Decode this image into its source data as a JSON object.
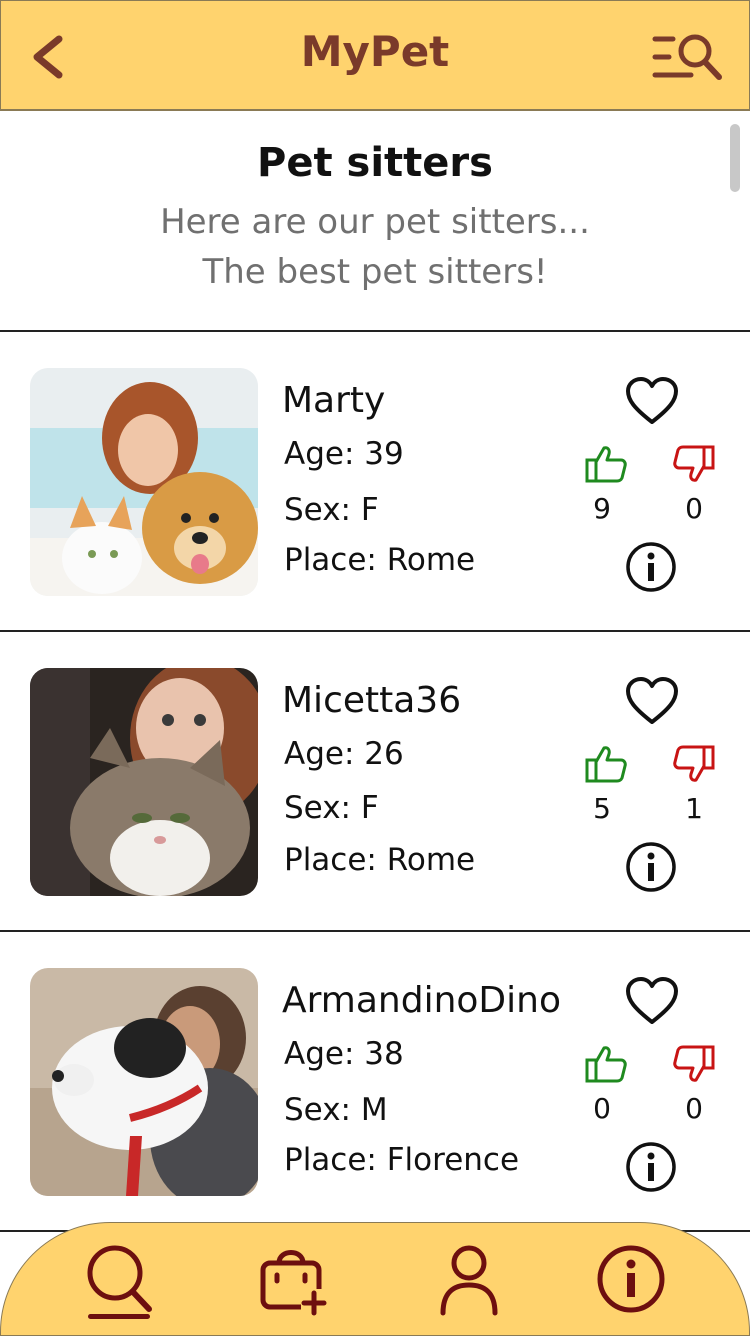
{
  "app": {
    "title": "MyPet"
  },
  "intro": {
    "title": "Pet sitters",
    "line1": "Here are our pet sitters...",
    "line2": "The best pet sitters!"
  },
  "sitters": [
    {
      "name": "Marty",
      "age": "Age: 39",
      "sex": "Sex: F",
      "place": "Place: Rome",
      "likes": "9",
      "dislikes": "0"
    },
    {
      "name": "Micetta36",
      "age": "Age: 26",
      "sex": "Sex: F",
      "place": "Place: Rome",
      "likes": "5",
      "dislikes": "1"
    },
    {
      "name": "ArmandinoDino",
      "age": "Age: 38",
      "sex": "Sex: M",
      "place": "Place: Florence",
      "likes": "0",
      "dislikes": "0"
    }
  ],
  "nav": {
    "items": [
      "search-icon",
      "bag-add-icon",
      "user-icon",
      "info-icon"
    ],
    "active": "search-icon"
  },
  "colors": {
    "accent": "#ffd36e",
    "brand_text": "#7a3a2a",
    "nav_icon": "#6d0f0f",
    "like": "#1f8a1f",
    "dislike": "#c81414"
  }
}
